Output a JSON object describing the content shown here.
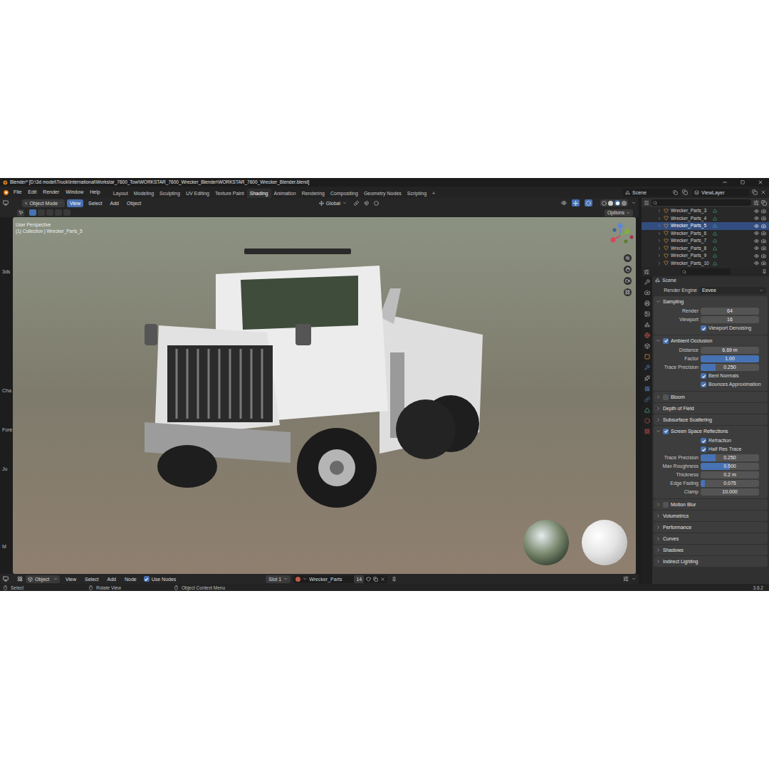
{
  "window": {
    "title": "Blender* [D:\\3d model\\Truck\\International\\Workstar_7600_Tow\\WORKSTAR_7600_Wrecker_Blender\\WORKSTAR_7600_Wrecker_Blender.blend]"
  },
  "menu": [
    "File",
    "Edit",
    "Render",
    "Window",
    "Help"
  ],
  "workspaces": [
    {
      "label": "Layout",
      "selected": false
    },
    {
      "label": "Modeling",
      "selected": false
    },
    {
      "label": "Sculpting",
      "selected": false
    },
    {
      "label": "UV Editing",
      "selected": false
    },
    {
      "label": "Texture Paint",
      "selected": false
    },
    {
      "label": "Shading",
      "selected": true
    },
    {
      "label": "Animation",
      "selected": false
    },
    {
      "label": "Rendering",
      "selected": false
    },
    {
      "label": "Compositing",
      "selected": false
    },
    {
      "label": "Geometry Nodes",
      "selected": false
    },
    {
      "label": "Scripting",
      "selected": false
    }
  ],
  "workspace_add": "+",
  "scene_selector": {
    "scene": "Scene",
    "view_layer": "ViewLayer"
  },
  "viewport_header": {
    "mode": "Object Mode",
    "menus": [
      {
        "label": "View",
        "selected": true
      },
      {
        "label": "Select",
        "selected": false
      },
      {
        "label": "Add",
        "selected": false
      },
      {
        "label": "Object",
        "selected": false
      }
    ],
    "orientation": "Global"
  },
  "tool_settings": {
    "options": "Options"
  },
  "viewport": {
    "view_name": "User Perspective",
    "collection": "(1) Collection | Wrecker_Parts_5"
  },
  "side_strip": [
    "3ds",
    "Cha",
    "Fore",
    "Ju",
    "M"
  ],
  "outliner": {
    "rows": [
      {
        "name": "Wrecker_Parts_3",
        "selected": false
      },
      {
        "name": "Wrecker_Parts_4",
        "selected": false
      },
      {
        "name": "Wrecker_Parts_5",
        "selected": true
      },
      {
        "name": "Wrecker_Parts_6",
        "selected": false
      },
      {
        "name": "Wrecker_Parts_7",
        "selected": false
      },
      {
        "name": "Wrecker_Parts_8",
        "selected": false
      },
      {
        "name": "Wrecker_Parts_9",
        "selected": false
      },
      {
        "name": "Wrecker_Parts_10",
        "selected": false
      }
    ]
  },
  "properties": {
    "breadcrumb": "Scene",
    "render_engine": {
      "label": "Render Engine",
      "value": "Eevee"
    },
    "panels": [
      {
        "label": "Sampling",
        "kind": "plain",
        "checked": false,
        "expanded": true,
        "rows": [
          {
            "kind": "field",
            "label": "Render",
            "value": "64"
          },
          {
            "kind": "field",
            "label": "Viewport",
            "value": "16"
          },
          {
            "kind": "checkbox",
            "label": "Viewport Denoising",
            "checked": true
          }
        ]
      },
      {
        "label": "Ambient Occlusion",
        "kind": "toggle",
        "checked": true,
        "expanded": true,
        "rows": [
          {
            "kind": "field",
            "label": "Distance",
            "value": "6.69 m"
          },
          {
            "kind": "slider",
            "label": "Factor",
            "value": "1.00",
            "level": 1
          },
          {
            "kind": "slider",
            "label": "Trace Precision",
            "value": "0.250",
            "level": 0.25
          },
          {
            "kind": "checkbox",
            "label": "Bent Normals",
            "checked": true
          },
          {
            "kind": "checkbox",
            "label": "Bounces Approximation",
            "checked": true
          }
        ]
      },
      {
        "label": "Bloom",
        "kind": "toggle",
        "checked": false,
        "expanded": false,
        "rows": []
      },
      {
        "label": "Depth of Field",
        "kind": "plain",
        "checked": false,
        "expanded": false,
        "rows": []
      },
      {
        "label": "Subsurface Scattering",
        "kind": "plain",
        "checked": false,
        "expanded": false,
        "rows": []
      },
      {
        "label": "Screen Space Reflections",
        "kind": "toggle",
        "checked": true,
        "expanded": true,
        "rows": [
          {
            "kind": "checkbox",
            "label": "Refraction",
            "checked": true
          },
          {
            "kind": "checkbox",
            "label": "Half Res Trace",
            "checked": true
          },
          {
            "kind": "slider",
            "label": "Trace Precision",
            "value": "0.250",
            "level": 0.25
          },
          {
            "kind": "slider",
            "label": "Max Roughness",
            "value": "0.500",
            "level": 0.5
          },
          {
            "kind": "field",
            "label": "Thickness",
            "value": "0.2 m"
          },
          {
            "kind": "slider",
            "label": "Edge Fading",
            "value": "0.075",
            "level": 0.075
          },
          {
            "kind": "field",
            "label": "Clamp",
            "value": "10.000"
          }
        ]
      },
      {
        "label": "Motion Blur",
        "kind": "toggle",
        "checked": false,
        "expanded": false,
        "rows": []
      },
      {
        "label": "Volumetrics",
        "kind": "plain",
        "checked": false,
        "expanded": false,
        "rows": []
      },
      {
        "label": "Performance",
        "kind": "plain",
        "checked": false,
        "expanded": false,
        "rows": []
      },
      {
        "label": "Curves",
        "kind": "plain",
        "checked": false,
        "expanded": false,
        "rows": []
      },
      {
        "label": "Shadows",
        "kind": "plain",
        "checked": false,
        "expanded": false,
        "rows": []
      },
      {
        "label": "Indirect Lighting",
        "kind": "plain",
        "checked": false,
        "expanded": false,
        "rows": []
      }
    ]
  },
  "shader_header": {
    "mode": "Object",
    "menus": [
      "View",
      "Select",
      "Add",
      "Node"
    ],
    "use_nodes": {
      "label": "Use Nodes",
      "checked": true
    },
    "slot": "Slot 1",
    "material": "Wrecker_Parts",
    "users": "14"
  },
  "status_bar": {
    "hints": [
      "Select",
      "Rotate View",
      "Object Context Menu"
    ],
    "version": "3.6.2"
  }
}
